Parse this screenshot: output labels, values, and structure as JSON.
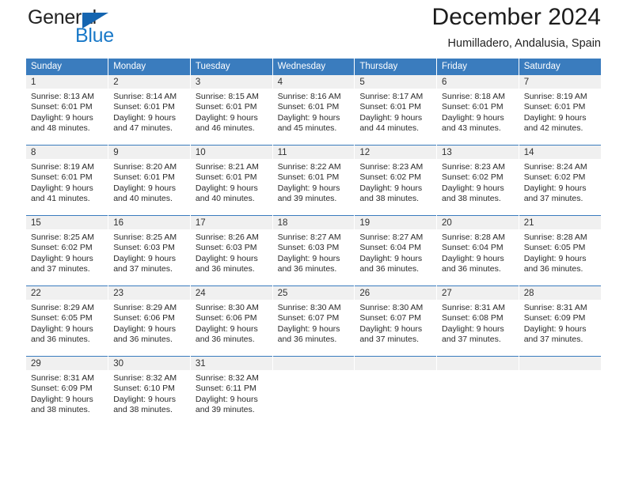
{
  "brand": {
    "name_top": "General",
    "name_bottom": "Blue",
    "accent_color": "#1a79c8",
    "triangle_color": "#1565b0"
  },
  "header": {
    "title": "December 2024",
    "subtitle": "Humilladero, Andalusia, Spain"
  },
  "calendar": {
    "header_bg": "#3a7cbe",
    "daynum_bg": "#f0f0f0",
    "weekdays": [
      "Sunday",
      "Monday",
      "Tuesday",
      "Wednesday",
      "Thursday",
      "Friday",
      "Saturday"
    ],
    "weeks": [
      [
        {
          "day": "1",
          "sunrise": "Sunrise: 8:13 AM",
          "sunset": "Sunset: 6:01 PM",
          "daylight1": "Daylight: 9 hours",
          "daylight2": "and 48 minutes."
        },
        {
          "day": "2",
          "sunrise": "Sunrise: 8:14 AM",
          "sunset": "Sunset: 6:01 PM",
          "daylight1": "Daylight: 9 hours",
          "daylight2": "and 47 minutes."
        },
        {
          "day": "3",
          "sunrise": "Sunrise: 8:15 AM",
          "sunset": "Sunset: 6:01 PM",
          "daylight1": "Daylight: 9 hours",
          "daylight2": "and 46 minutes."
        },
        {
          "day": "4",
          "sunrise": "Sunrise: 8:16 AM",
          "sunset": "Sunset: 6:01 PM",
          "daylight1": "Daylight: 9 hours",
          "daylight2": "and 45 minutes."
        },
        {
          "day": "5",
          "sunrise": "Sunrise: 8:17 AM",
          "sunset": "Sunset: 6:01 PM",
          "daylight1": "Daylight: 9 hours",
          "daylight2": "and 44 minutes."
        },
        {
          "day": "6",
          "sunrise": "Sunrise: 8:18 AM",
          "sunset": "Sunset: 6:01 PM",
          "daylight1": "Daylight: 9 hours",
          "daylight2": "and 43 minutes."
        },
        {
          "day": "7",
          "sunrise": "Sunrise: 8:19 AM",
          "sunset": "Sunset: 6:01 PM",
          "daylight1": "Daylight: 9 hours",
          "daylight2": "and 42 minutes."
        }
      ],
      [
        {
          "day": "8",
          "sunrise": "Sunrise: 8:19 AM",
          "sunset": "Sunset: 6:01 PM",
          "daylight1": "Daylight: 9 hours",
          "daylight2": "and 41 minutes."
        },
        {
          "day": "9",
          "sunrise": "Sunrise: 8:20 AM",
          "sunset": "Sunset: 6:01 PM",
          "daylight1": "Daylight: 9 hours",
          "daylight2": "and 40 minutes."
        },
        {
          "day": "10",
          "sunrise": "Sunrise: 8:21 AM",
          "sunset": "Sunset: 6:01 PM",
          "daylight1": "Daylight: 9 hours",
          "daylight2": "and 40 minutes."
        },
        {
          "day": "11",
          "sunrise": "Sunrise: 8:22 AM",
          "sunset": "Sunset: 6:01 PM",
          "daylight1": "Daylight: 9 hours",
          "daylight2": "and 39 minutes."
        },
        {
          "day": "12",
          "sunrise": "Sunrise: 8:23 AM",
          "sunset": "Sunset: 6:02 PM",
          "daylight1": "Daylight: 9 hours",
          "daylight2": "and 38 minutes."
        },
        {
          "day": "13",
          "sunrise": "Sunrise: 8:23 AM",
          "sunset": "Sunset: 6:02 PM",
          "daylight1": "Daylight: 9 hours",
          "daylight2": "and 38 minutes."
        },
        {
          "day": "14",
          "sunrise": "Sunrise: 8:24 AM",
          "sunset": "Sunset: 6:02 PM",
          "daylight1": "Daylight: 9 hours",
          "daylight2": "and 37 minutes."
        }
      ],
      [
        {
          "day": "15",
          "sunrise": "Sunrise: 8:25 AM",
          "sunset": "Sunset: 6:02 PM",
          "daylight1": "Daylight: 9 hours",
          "daylight2": "and 37 minutes."
        },
        {
          "day": "16",
          "sunrise": "Sunrise: 8:25 AM",
          "sunset": "Sunset: 6:03 PM",
          "daylight1": "Daylight: 9 hours",
          "daylight2": "and 37 minutes."
        },
        {
          "day": "17",
          "sunrise": "Sunrise: 8:26 AM",
          "sunset": "Sunset: 6:03 PM",
          "daylight1": "Daylight: 9 hours",
          "daylight2": "and 36 minutes."
        },
        {
          "day": "18",
          "sunrise": "Sunrise: 8:27 AM",
          "sunset": "Sunset: 6:03 PM",
          "daylight1": "Daylight: 9 hours",
          "daylight2": "and 36 minutes."
        },
        {
          "day": "19",
          "sunrise": "Sunrise: 8:27 AM",
          "sunset": "Sunset: 6:04 PM",
          "daylight1": "Daylight: 9 hours",
          "daylight2": "and 36 minutes."
        },
        {
          "day": "20",
          "sunrise": "Sunrise: 8:28 AM",
          "sunset": "Sunset: 6:04 PM",
          "daylight1": "Daylight: 9 hours",
          "daylight2": "and 36 minutes."
        },
        {
          "day": "21",
          "sunrise": "Sunrise: 8:28 AM",
          "sunset": "Sunset: 6:05 PM",
          "daylight1": "Daylight: 9 hours",
          "daylight2": "and 36 minutes."
        }
      ],
      [
        {
          "day": "22",
          "sunrise": "Sunrise: 8:29 AM",
          "sunset": "Sunset: 6:05 PM",
          "daylight1": "Daylight: 9 hours",
          "daylight2": "and 36 minutes."
        },
        {
          "day": "23",
          "sunrise": "Sunrise: 8:29 AM",
          "sunset": "Sunset: 6:06 PM",
          "daylight1": "Daylight: 9 hours",
          "daylight2": "and 36 minutes."
        },
        {
          "day": "24",
          "sunrise": "Sunrise: 8:30 AM",
          "sunset": "Sunset: 6:06 PM",
          "daylight1": "Daylight: 9 hours",
          "daylight2": "and 36 minutes."
        },
        {
          "day": "25",
          "sunrise": "Sunrise: 8:30 AM",
          "sunset": "Sunset: 6:07 PM",
          "daylight1": "Daylight: 9 hours",
          "daylight2": "and 36 minutes."
        },
        {
          "day": "26",
          "sunrise": "Sunrise: 8:30 AM",
          "sunset": "Sunset: 6:07 PM",
          "daylight1": "Daylight: 9 hours",
          "daylight2": "and 37 minutes."
        },
        {
          "day": "27",
          "sunrise": "Sunrise: 8:31 AM",
          "sunset": "Sunset: 6:08 PM",
          "daylight1": "Daylight: 9 hours",
          "daylight2": "and 37 minutes."
        },
        {
          "day": "28",
          "sunrise": "Sunrise: 8:31 AM",
          "sunset": "Sunset: 6:09 PM",
          "daylight1": "Daylight: 9 hours",
          "daylight2": "and 37 minutes."
        }
      ],
      [
        {
          "day": "29",
          "sunrise": "Sunrise: 8:31 AM",
          "sunset": "Sunset: 6:09 PM",
          "daylight1": "Daylight: 9 hours",
          "daylight2": "and 38 minutes."
        },
        {
          "day": "30",
          "sunrise": "Sunrise: 8:32 AM",
          "sunset": "Sunset: 6:10 PM",
          "daylight1": "Daylight: 9 hours",
          "daylight2": "and 38 minutes."
        },
        {
          "day": "31",
          "sunrise": "Sunrise: 8:32 AM",
          "sunset": "Sunset: 6:11 PM",
          "daylight1": "Daylight: 9 hours",
          "daylight2": "and 39 minutes."
        },
        {
          "day": "",
          "sunrise": "",
          "sunset": "",
          "daylight1": "",
          "daylight2": ""
        },
        {
          "day": "",
          "sunrise": "",
          "sunset": "",
          "daylight1": "",
          "daylight2": ""
        },
        {
          "day": "",
          "sunrise": "",
          "sunset": "",
          "daylight1": "",
          "daylight2": ""
        },
        {
          "day": "",
          "sunrise": "",
          "sunset": "",
          "daylight1": "",
          "daylight2": ""
        }
      ]
    ]
  }
}
